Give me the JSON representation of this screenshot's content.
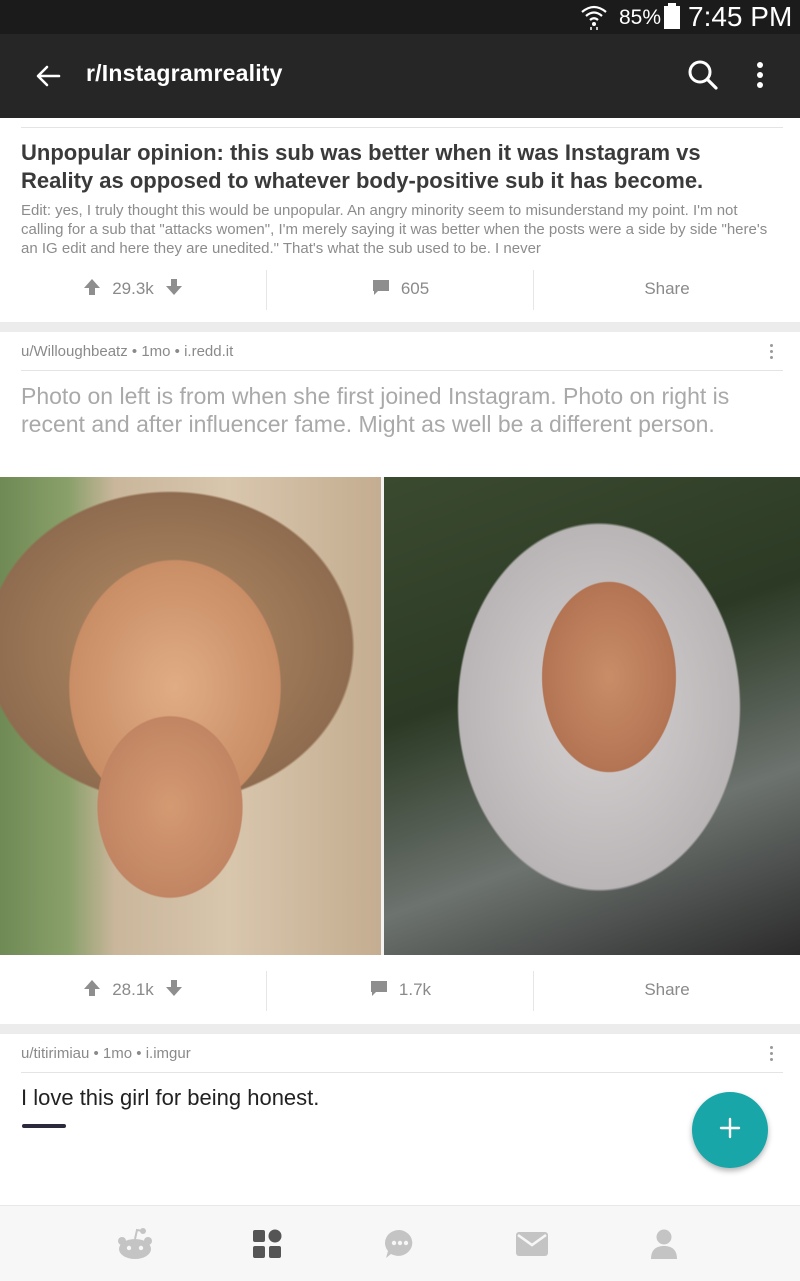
{
  "status_bar": {
    "battery": "85%",
    "time": "7:45 PM"
  },
  "header": {
    "title": "r/Instagramreality"
  },
  "posts": [
    {
      "title": "Unpopular opinion: this sub was better when it was Instagram vs Reality as opposed to whatever body-positive sub it has become.",
      "body": "Edit: yes, I truly thought this would be unpopular. An angry minority seem to misunderstand my point. I'm not calling for a sub that \"attacks women\", I'm merely saying it was better when the posts were a side by side \"here's an IG edit and here they are unedited.\" That's what the sub used to be. I never",
      "score": "29.3k",
      "comments": "605",
      "share": "Share"
    },
    {
      "meta": "u/Willoughbeatz • 1mo • i.redd.it",
      "title": "Photo on left is from when she first joined Instagram. Photo on right is recent and after influencer fame. Might as well be a different person.",
      "score": "28.1k",
      "comments": "1.7k",
      "share": "Share"
    },
    {
      "meta": "u/titirimiau • 1mo • i.imgur",
      "title": "I love this girl for being honest."
    }
  ],
  "fab": {
    "icon": "plus-icon"
  },
  "bottom_nav": [
    "home-icon",
    "communities-icon",
    "chat-icon",
    "inbox-icon",
    "profile-icon"
  ],
  "colors": {
    "header_bg": "#262626",
    "fab": "#18a6a8",
    "meta_text": "#8a8a8a"
  }
}
